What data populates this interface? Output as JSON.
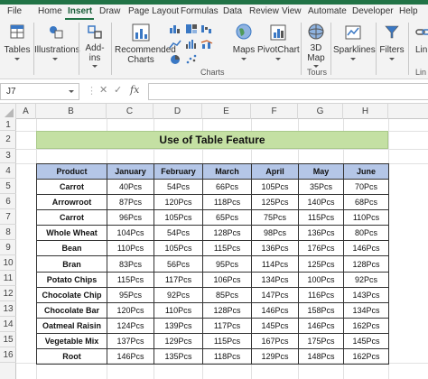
{
  "tabs": [
    "File",
    "Home",
    "Insert",
    "Draw",
    "Page Layout",
    "Formulas",
    "Data",
    "Review",
    "View",
    "Automate",
    "Developer",
    "Help"
  ],
  "active_tab": "Insert",
  "ribbon": {
    "tables": "Tables",
    "illustrations": "Illustrations",
    "addins_line1": "Add-",
    "addins_line2": "ins",
    "recommended_charts_line1": "Recommended",
    "recommended_charts_line2": "Charts",
    "maps": "Maps",
    "pivotchart": "PivotChart",
    "map3d_line1": "3D",
    "map3d_line2": "Map",
    "sparklines": "Sparklines",
    "filters": "Filters",
    "links_partial": "Lin",
    "group_charts": "Charts",
    "group_tours": "Tours",
    "group_links_partial": "Lin"
  },
  "formula_bar": {
    "name_box": "J7",
    "fx": "fx",
    "formula": ""
  },
  "columns": [
    "A",
    "B",
    "C",
    "D",
    "E",
    "F",
    "G",
    "H"
  ],
  "rows": [
    "1",
    "2",
    "3",
    "4",
    "5",
    "6",
    "7",
    "8",
    "9",
    "10",
    "11",
    "12",
    "13",
    "14",
    "15",
    "16"
  ],
  "sheet": {
    "title": "Use of Table Feature",
    "headers": [
      "Product",
      "January",
      "February",
      "March",
      "April",
      "May",
      "June"
    ],
    "rows": [
      [
        "Carrot",
        "40Pcs",
        "54Pcs",
        "66Pcs",
        "105Pcs",
        "35Pcs",
        "70Pcs"
      ],
      [
        "Arrowroot",
        "87Pcs",
        "120Pcs",
        "118Pcs",
        "125Pcs",
        "140Pcs",
        "68Pcs"
      ],
      [
        "Carrot",
        "96Pcs",
        "105Pcs",
        "65Pcs",
        "75Pcs",
        "115Pcs",
        "110Pcs"
      ],
      [
        "Whole Wheat",
        "104Pcs",
        "54Pcs",
        "128Pcs",
        "98Pcs",
        "136Pcs",
        "80Pcs"
      ],
      [
        "Bean",
        "110Pcs",
        "105Pcs",
        "115Pcs",
        "136Pcs",
        "176Pcs",
        "146Pcs"
      ],
      [
        "Bran",
        "83Pcs",
        "56Pcs",
        "95Pcs",
        "114Pcs",
        "125Pcs",
        "128Pcs"
      ],
      [
        "Potato Chips",
        "115Pcs",
        "117Pcs",
        "106Pcs",
        "134Pcs",
        "100Pcs",
        "92Pcs"
      ],
      [
        "Chocolate Chip",
        "95Pcs",
        "92Pcs",
        "85Pcs",
        "147Pcs",
        "116Pcs",
        "143Pcs"
      ],
      [
        "Chocolate Bar",
        "120Pcs",
        "110Pcs",
        "128Pcs",
        "146Pcs",
        "158Pcs",
        "134Pcs"
      ],
      [
        "Oatmeal Raisin",
        "124Pcs",
        "139Pcs",
        "117Pcs",
        "145Pcs",
        "146Pcs",
        "162Pcs"
      ],
      [
        "Vegetable Mix",
        "137Pcs",
        "129Pcs",
        "115Pcs",
        "167Pcs",
        "175Pcs",
        "145Pcs"
      ],
      [
        "Root",
        "146Pcs",
        "135Pcs",
        "118Pcs",
        "129Pcs",
        "148Pcs",
        "162Pcs"
      ]
    ]
  },
  "colors": {
    "excel_green": "#217346",
    "title_fill": "#c4e0a3",
    "header_fill": "#b4c6e7"
  }
}
